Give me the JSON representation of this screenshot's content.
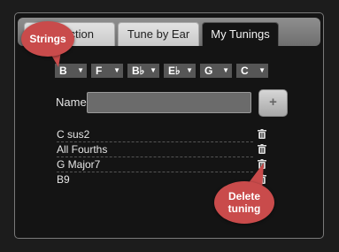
{
  "tabs": [
    {
      "label": "Detection",
      "active": false
    },
    {
      "label": "Tune by Ear",
      "active": false
    },
    {
      "label": "My Tunings",
      "active": true
    }
  ],
  "strings": [
    {
      "note": "B"
    },
    {
      "note": "F"
    },
    {
      "note": "B♭"
    },
    {
      "note": "E♭"
    },
    {
      "note": "G"
    },
    {
      "note": "C"
    }
  ],
  "name_field": {
    "label": "Name",
    "value": "",
    "placeholder": ""
  },
  "add_button": {
    "label": "+"
  },
  "tunings": [
    "C sus2",
    "All Fourths",
    "G Major7",
    "B9"
  ],
  "callouts": {
    "strings": "Strings",
    "delete": "Delete tuning"
  },
  "colors": {
    "background": "#1c1c1c",
    "callout": "#c94b4b",
    "select": "#565656"
  }
}
